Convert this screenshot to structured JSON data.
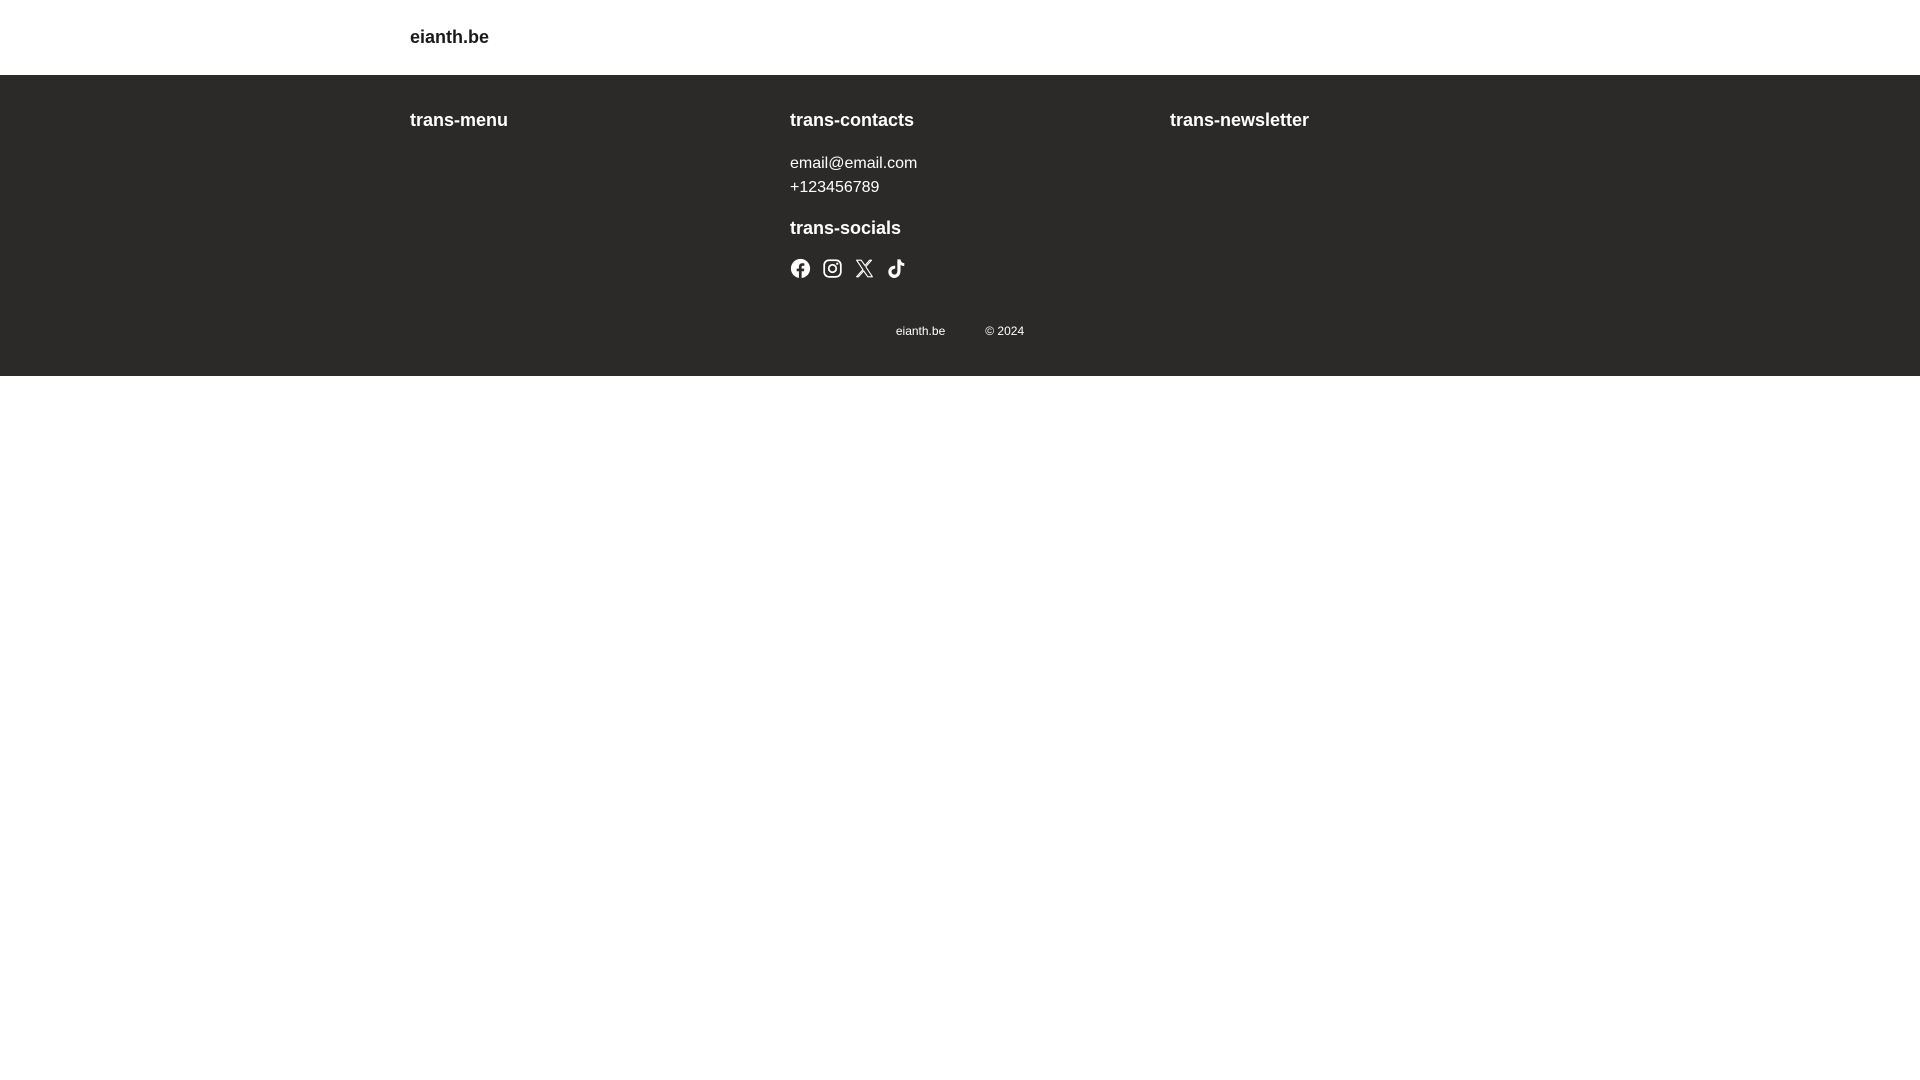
{
  "header": {
    "brand": "eianth.be"
  },
  "footer": {
    "menu": {
      "title": "trans-menu"
    },
    "contacts": {
      "title": "trans-contacts",
      "email": "email@email.com",
      "phone": "+123456789"
    },
    "socials": {
      "title": "trans-socials",
      "icons": [
        "facebook-icon",
        "instagram-icon",
        "x-icon",
        "tiktok-icon"
      ]
    },
    "newsletter": {
      "title": "trans-newsletter"
    },
    "bottom": {
      "site": "eianth.be",
      "copyright": "© 2024"
    }
  },
  "colors": {
    "footer_bg": "#2b2a29",
    "text_light": "#ffffff",
    "text_dark": "#1a1a1a"
  }
}
